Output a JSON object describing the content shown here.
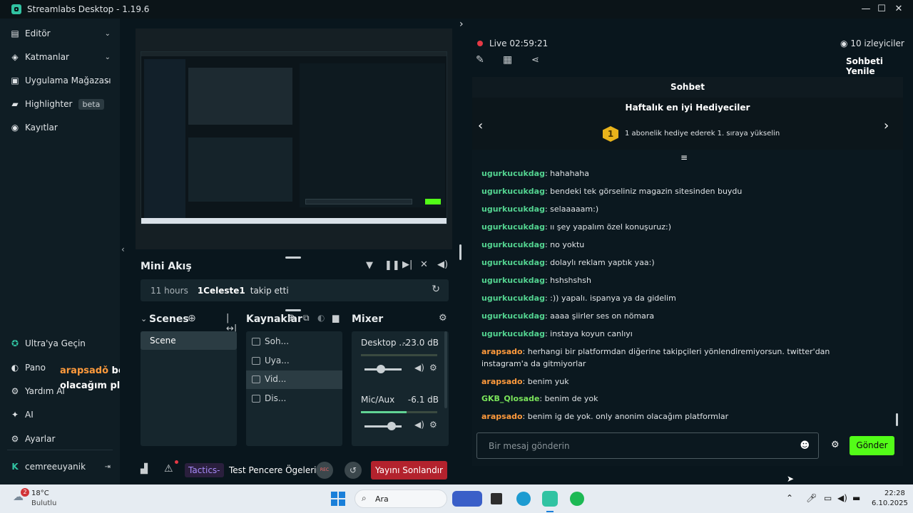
{
  "app": {
    "title": "Streamlabs Desktop - 1.19.6"
  },
  "nav": {
    "items": [
      {
        "label": "Editör"
      },
      {
        "label": "Katmanlar"
      },
      {
        "label": "Uygulama Mağazası"
      },
      {
        "label": "Highlighter",
        "badge": "beta"
      },
      {
        "label": "Kayıtlar"
      }
    ],
    "bottom": [
      {
        "label": "Ultra'ya Geçin"
      },
      {
        "label": "Pano"
      },
      {
        "label": "Yardım Al"
      },
      {
        "label": "AI"
      },
      {
        "label": "Ayarlar"
      }
    ],
    "user": "cemreeuyanik"
  },
  "overlay": {
    "user": "arapsadǒ",
    "text": "benim ig de yok. only anonim olacağım platformlar"
  },
  "mini": {
    "title": "Mini Akış",
    "event": {
      "time": "11 hours",
      "user": "1Celeste1",
      "action": "takip etti"
    }
  },
  "scenes": {
    "title": "Scenes",
    "items": [
      "Scene"
    ]
  },
  "sources": {
    "title": "Kaynaklar",
    "items": [
      "Soh...",
      "Uya...",
      "Vid...",
      "Dis..."
    ]
  },
  "mixer": {
    "title": "Mixer",
    "channels": [
      {
        "name": "Desktop ...",
        "level": "-23.0 dB",
        "slider": 0.44
      },
      {
        "name": "Mic/Aux",
        "level": "-6.1 dB",
        "slider": 0.74
      }
    ]
  },
  "bottombar": {
    "tab1": "Tactics-",
    "tab2": "Test Pencere Ögeleri",
    "rec": "REC",
    "end": "Yayını Sonlandır"
  },
  "live": {
    "label": "Live",
    "time": "02:59:21",
    "viewers": "10 izleyiciler",
    "refresh": "Sohbeti Yenile"
  },
  "chat": {
    "header": "Sohbet",
    "gifters_title": "Haftalık en iyi Hediyeciler",
    "rank": "1",
    "gifters_text": "1 abonelik hediye ederek 1. sıraya yükselin",
    "messages": [
      {
        "user": "ugurkucukdag",
        "text": ": hahahaha",
        "color": "green"
      },
      {
        "user": "ugurkucukdag",
        "text": ": bendeki tek görseliniz magazin sitesinden buydu",
        "color": "green"
      },
      {
        "user": "ugurkucukdag",
        "text": ": selaaaaam:)",
        "color": "green"
      },
      {
        "user": "ugurkucukdag",
        "text": ": ıı şey yapalım özel konuşuruz:)",
        "color": "green"
      },
      {
        "user": "ugurkucukdag",
        "text": ": no yoktu",
        "color": "green"
      },
      {
        "user": "ugurkucukdag",
        "text": ": dolaylı reklam yaptık yaa:)",
        "color": "green"
      },
      {
        "user": "ugurkucukdag",
        "text": ": hshshshsh",
        "color": "green"
      },
      {
        "user": "ugurkucukdag",
        "text": ": :)) yapalı. ispanya ya da gidelim",
        "color": "green"
      },
      {
        "user": "ugurkucukdag",
        "text": ": aaaa şiirler ses on nömara",
        "color": "green"
      },
      {
        "user": "ugurkucukdag",
        "text": ": instaya koyun canlıyı",
        "color": "green"
      },
      {
        "user": "arapsado",
        "text": ": herhangi bir platformdan diğerine takipçileri yönlendiremiyorsun. twitter'dan instagram'a da gitmiyorlar",
        "color": "orange"
      },
      {
        "user": "arapsado",
        "text": ": benim yuk",
        "color": "orange"
      },
      {
        "user": "GKB_Qlosade",
        "text": ": benim de yok",
        "color": "lime"
      },
      {
        "user": "arapsado",
        "text": ": benim ig de yok. only anonim olacağım platformlar",
        "color": "orange"
      }
    ],
    "input_placeholder": "Bir mesaj gönderin",
    "send": "Gönder"
  },
  "taskbar": {
    "weather_temp": "18°C",
    "weather_desc": "Bulutlu",
    "weather_badge": "2",
    "search": "Ara",
    "time": "22:28",
    "date": "6.10.2025"
  },
  "colors": {
    "accent": "#31c3a2",
    "send": "#80f5d2",
    "end": "#b3222d"
  }
}
